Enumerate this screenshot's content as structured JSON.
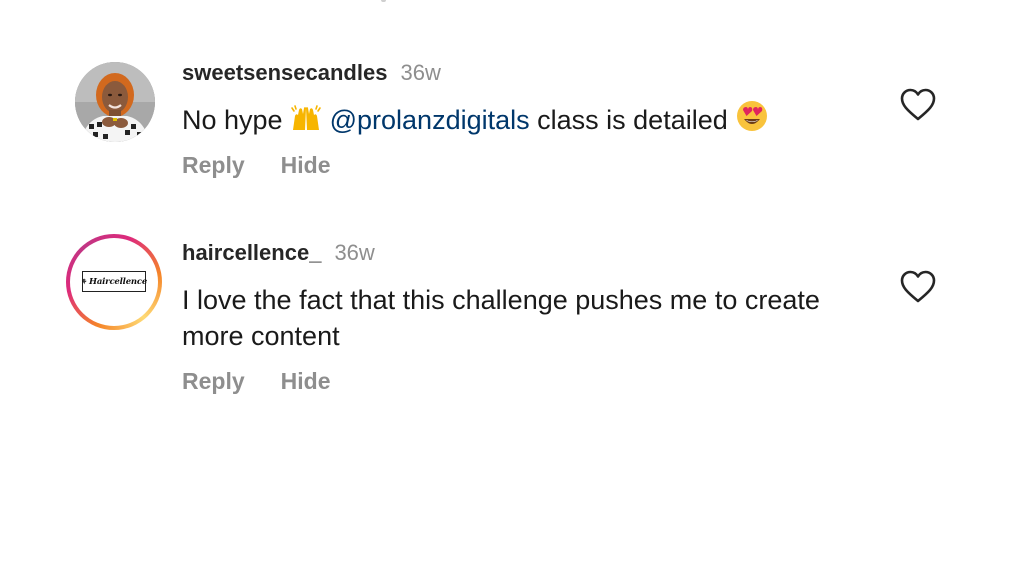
{
  "comments": [
    {
      "username": "sweetsensecandles",
      "time": "36w",
      "text_before": "No hype",
      "emoji_1": "raising-hands",
      "mention": "@prolanzdigitals",
      "text_after": "class is detailed",
      "emoji_2": "heart-eyes",
      "reply_label": "Reply",
      "hide_label": "Hide"
    },
    {
      "username": "haircellence_",
      "time": "36w",
      "text": "I love the fact that this challenge pushes me to create more content",
      "avatar_logo_text": "Haircellence",
      "reply_label": "Reply",
      "hide_label": "Hide"
    }
  ],
  "colors": {
    "username": "#262626",
    "meta_gray": "#8e8e8e",
    "mention_blue": "#00376b",
    "story_ring": [
      "#f58529",
      "#dd2a7b",
      "#feda75"
    ]
  }
}
